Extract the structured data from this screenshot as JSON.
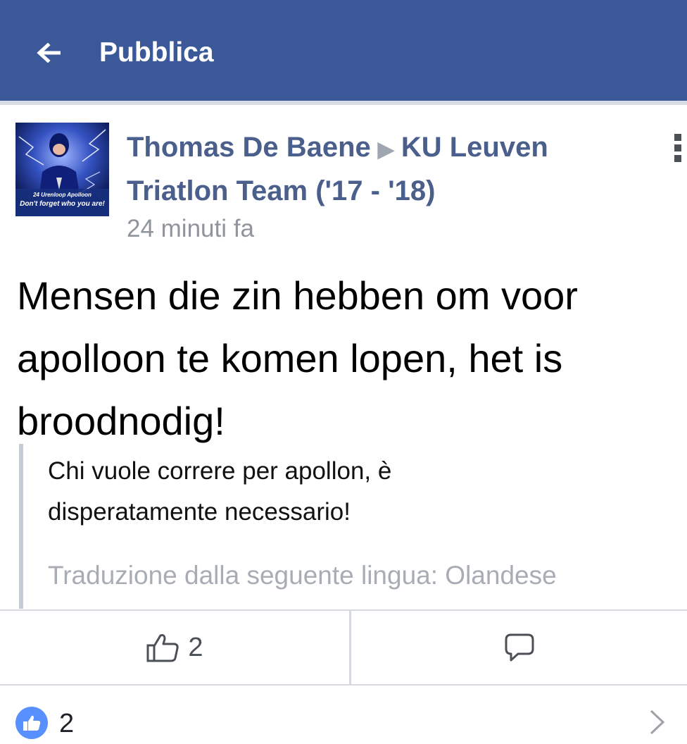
{
  "topbar": {
    "title": "Pubblica",
    "back_icon": "arrow-left-icon",
    "bg_color": "#3b5998"
  },
  "post": {
    "author": "Thomas De Baene",
    "group": "KU Leuven Triatlon Team ('17 - '18)",
    "timestamp": "24 minuti fa",
    "avatar_caption_1": "24 Urenloop Apolloon",
    "avatar_caption_2": "Don't forget who you are!",
    "body_lines": [
      "Mensen die zin hebben om voor",
      "apolloon te komen lopen, het is",
      "broodnodig!"
    ],
    "translation": {
      "lines": [
        "Chi vuole correre per apollon, è",
        "disperatamente necessario!"
      ],
      "source_language": "Traduzione dalla seguente lingua: Olandese"
    }
  },
  "actions": {
    "like_count": "2",
    "like_icon": "thumbs-up-outline-icon",
    "comment_icon": "comment-bubble-icon"
  },
  "reactions": {
    "count": "2",
    "badge_icon": "like-badge-icon",
    "chevron_icon": "chevron-right-icon",
    "badge_color": "#5890ff"
  }
}
